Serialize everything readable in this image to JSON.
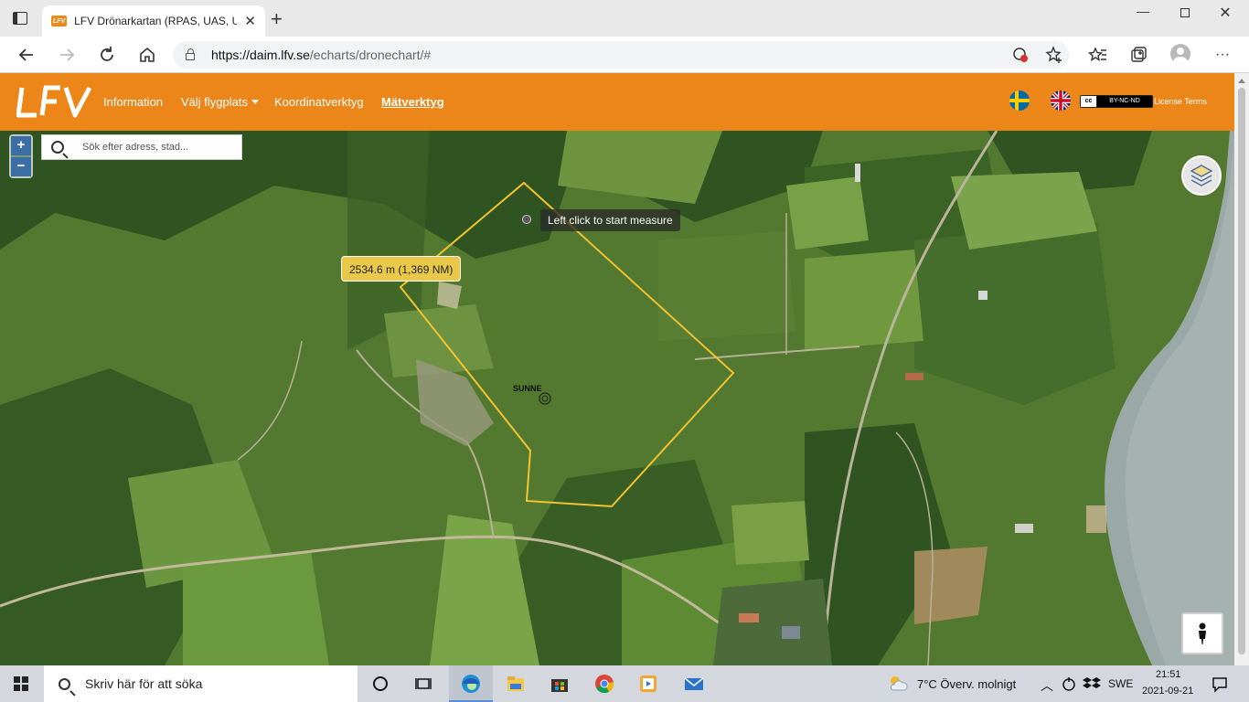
{
  "browser": {
    "tab_title": "LFV Drönarkartan (RPAS, UAS, UA",
    "tab_favicon_text": "LFV",
    "url_host": "https://daim.lfv.se",
    "url_path": "/echarts/dronechart/#"
  },
  "site": {
    "logo_text": "LFV",
    "nav": [
      {
        "label": "Information"
      },
      {
        "label": "Välj flygplats"
      },
      {
        "label": "Koordinatverktyg"
      },
      {
        "label": "Mätverktyg"
      }
    ],
    "cc_left": "cc",
    "cc_badge": "BY-NC-ND",
    "license_label": "License Terms"
  },
  "map": {
    "zoom_in": "+",
    "zoom_out": "−",
    "search_placeholder": "Sök efter adress, stad...",
    "tooltip": "Left click to start measure",
    "distance": "2534.6 m (1,369 NM)",
    "place_label": "SUNNE",
    "polygon_color": "#f2c32e"
  },
  "taskbar": {
    "search_placeholder": "Skriv här för att söka",
    "weather": "7°C  Överv. molnigt",
    "lang": "SWE",
    "time": "21:51",
    "date": "2021-09-21"
  }
}
